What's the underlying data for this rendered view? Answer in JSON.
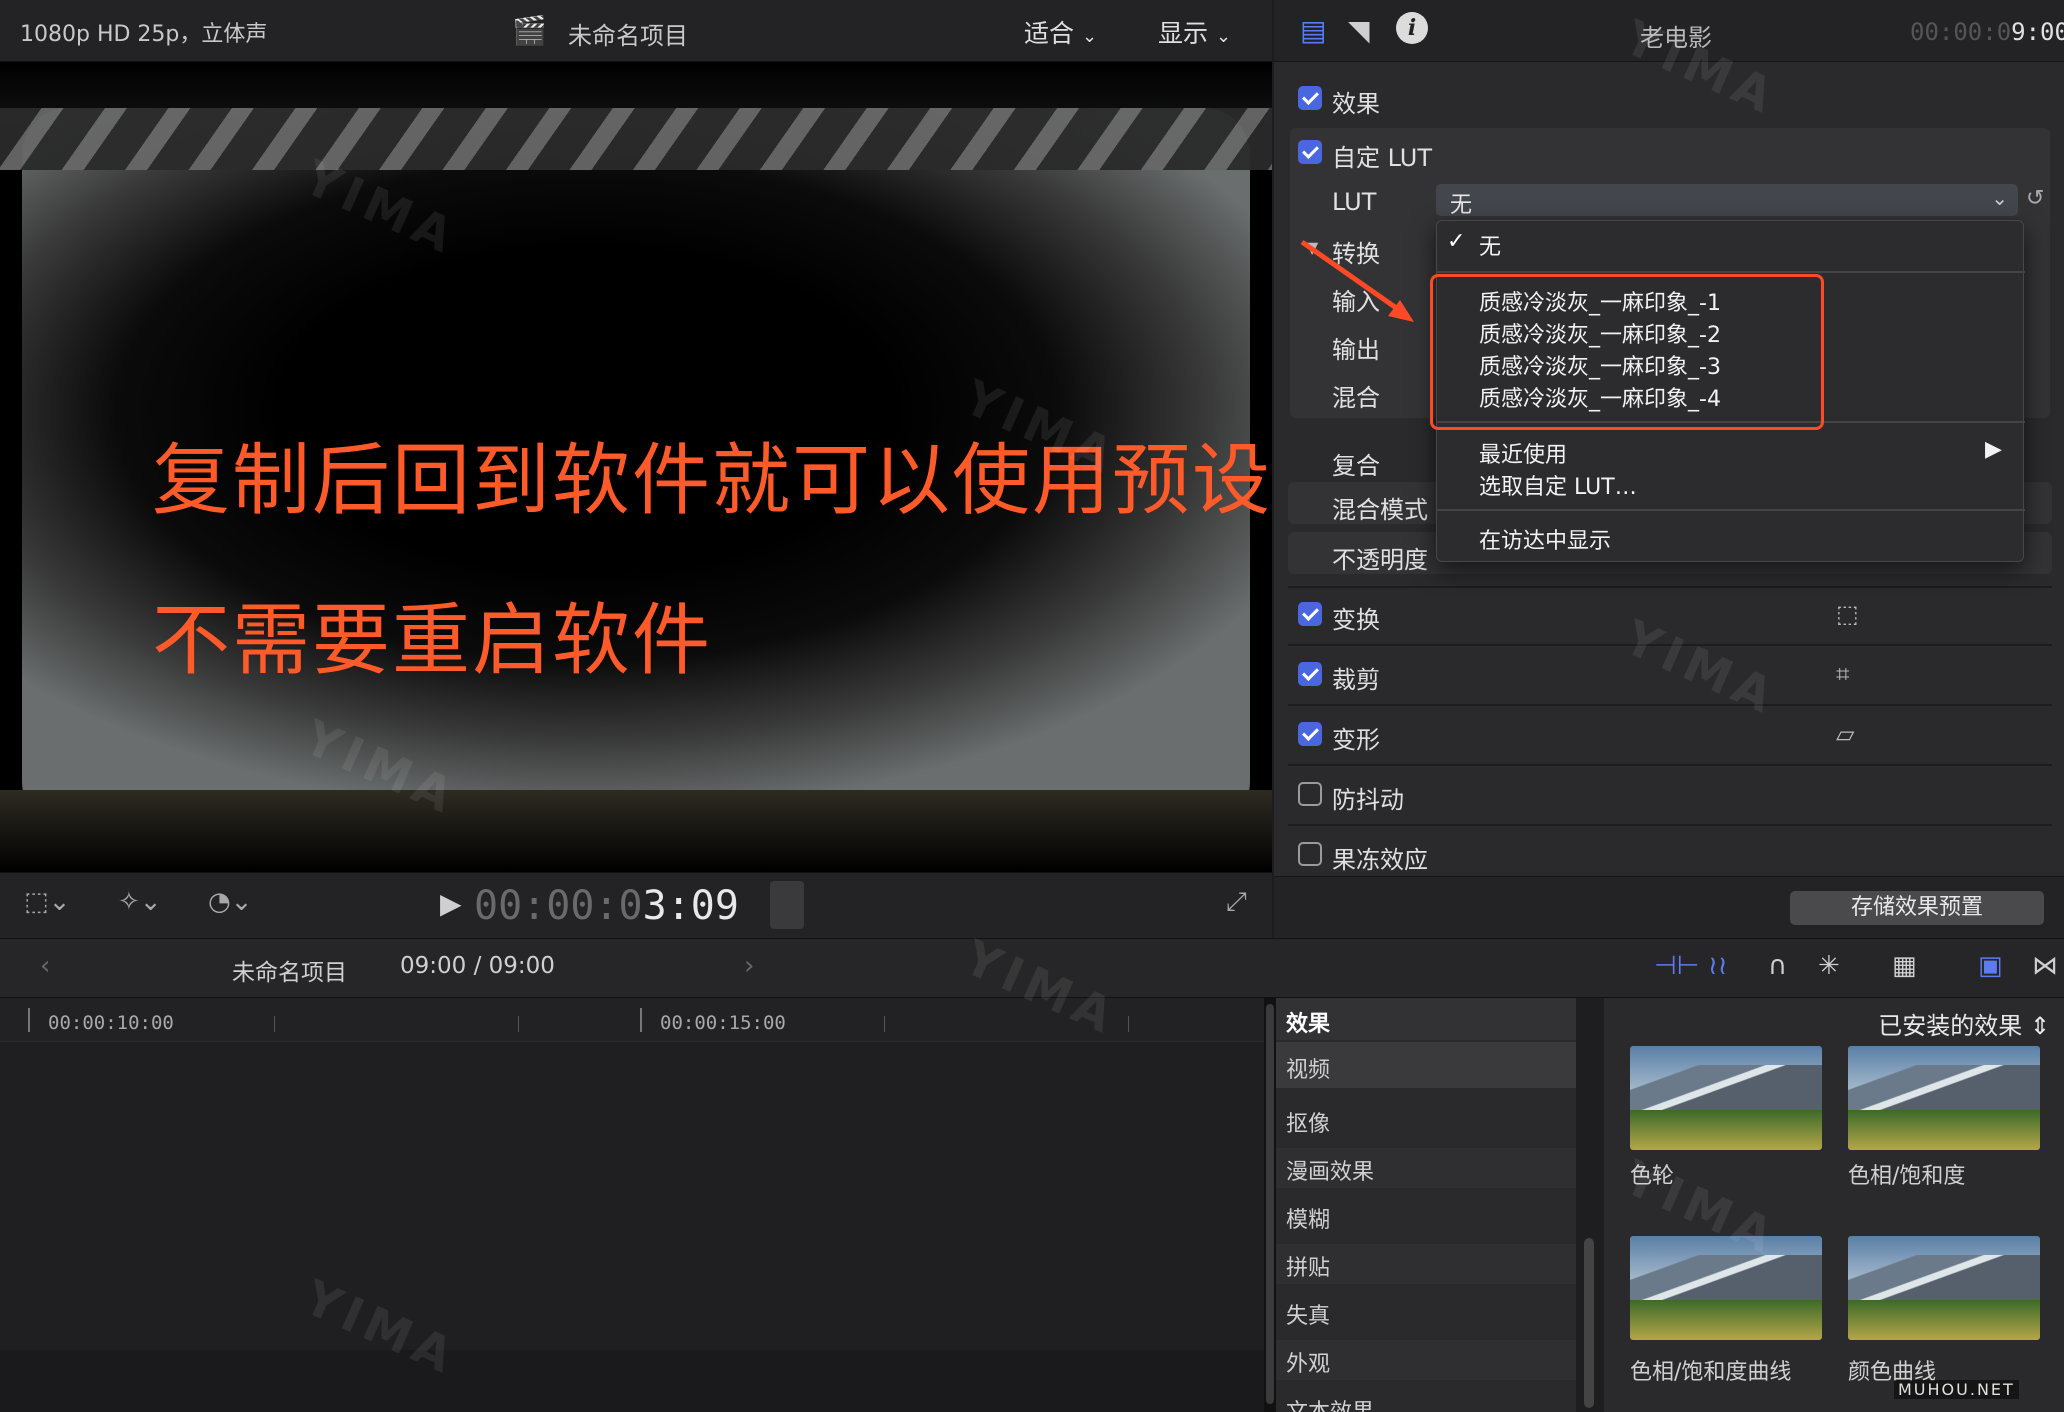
{
  "viewer": {
    "format": "1080p HD 25p，立体声",
    "project_title": "未命名项目",
    "fit_menu": "适合",
    "display_menu": "显示",
    "overlay_line1": "复制后回到软件就可以使用预设了",
    "overlay_line2": "不需要重启软件",
    "timecode_dim": "00:00:0",
    "timecode_bright": "3:09"
  },
  "inspector": {
    "clip_name": "老电影",
    "timecode_dim": "00:00:0",
    "timecode_bright": "9:00",
    "effects_label": "效果",
    "custom_lut_label": "自定 LUT",
    "lut_label": "LUT",
    "lut_value": "无",
    "convert_label": "转换",
    "input_label": "输入",
    "output_label": "输出",
    "mix_label": "混合",
    "composite_label": "复合",
    "blend_mode_label": "混合模式",
    "opacity_label": "不透明度",
    "transform_label": "变换",
    "crop_label": "裁剪",
    "distort_label": "变形",
    "stabilize_label": "防抖动",
    "rolling_label": "果冻效应",
    "save_preset_button": "存储效果预置"
  },
  "dropdown": {
    "items": [
      {
        "label": "无",
        "checked": true
      },
      {
        "label": "质感冷淡灰_一麻印象_-1"
      },
      {
        "label": "质感冷淡灰_一麻印象_-2"
      },
      {
        "label": "质感冷淡灰_一麻印象_-3"
      },
      {
        "label": "质感冷淡灰_一麻印象_-4"
      },
      {
        "label": "最近使用"
      },
      {
        "label": "选取自定 LUT…"
      },
      {
        "label": "在访达中显示"
      }
    ]
  },
  "timeline_bar": {
    "project": "未命名项目",
    "duration": "09:00 / 09:00",
    "ruler_a": "00:00:10:00",
    "ruler_b": "00:00:15:00"
  },
  "browser": {
    "header": "效果",
    "filter": "已安装的效果",
    "categories": [
      "视频",
      "抠像",
      "漫画效果",
      "模糊",
      "拼贴",
      "失真",
      "外观",
      "文本效果"
    ],
    "thumbnails": [
      "色轮",
      "色相/饱和度",
      "色相/饱和度曲线",
      "颜色曲线"
    ]
  },
  "watermark": {
    "brand": "YIMA",
    "site": "MUHOU.NET"
  },
  "colors": {
    "accent": "#4b67e0",
    "highlight": "#ff4a25",
    "overlay_text": "#ff5a2a"
  }
}
